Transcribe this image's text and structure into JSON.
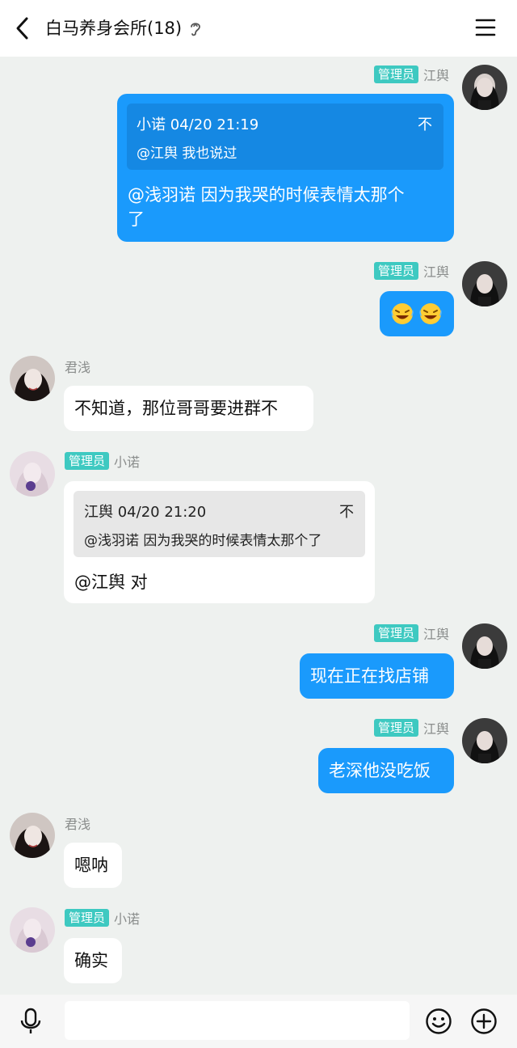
{
  "header": {
    "title": "白马养身会所(18)"
  },
  "messages": [
    {
      "side": "me",
      "badge": "管理员",
      "sender": "江舆",
      "quote": {
        "head": "小诺 04/20 21:19",
        "text": "@江舆 我也说过",
        "pin": "不"
      },
      "lines": [
        "@浅羽诺 因为我哭的时候表情太那个",
        "了"
      ]
    },
    {
      "side": "me",
      "badge": "管理员",
      "sender": "江舆",
      "emoji": [
        "laughing-crying-emoji",
        "laughing-crying-emoji"
      ]
    },
    {
      "side": "other",
      "sender": "君浅",
      "lines": [
        "不知道，那位哥哥要进群不"
      ]
    },
    {
      "side": "other",
      "badge": "管理员",
      "sender": "小诺",
      "quote": {
        "head": "江舆 04/20 21:20",
        "text": "@浅羽诺 因为我哭的时候表情太那个了",
        "pin": "不"
      },
      "lines": [
        "@江舆 对"
      ]
    },
    {
      "side": "me",
      "badge": "管理员",
      "sender": "江舆",
      "lines": [
        "现在正在找店铺"
      ]
    },
    {
      "side": "me",
      "badge": "管理员",
      "sender": "江舆",
      "lines": [
        "老深他没吃饭"
      ]
    },
    {
      "side": "other",
      "sender": "君浅",
      "lines": [
        "嗯呐"
      ]
    },
    {
      "side": "other",
      "badge": "管理员",
      "sender": "小诺",
      "lines": [
        "确实"
      ]
    }
  ],
  "input": {
    "value": "",
    "placeholder": ""
  },
  "colors": {
    "my_bubble": "#1a9afc",
    "admin_badge": "#3ec9c1",
    "background": "#eef1ef"
  },
  "icons": {
    "back": "chevron-left-icon",
    "ear": "ear-icon",
    "menu": "menu-icon",
    "voice": "microphone-icon",
    "emoji": "smiley-icon",
    "plus": "plus-circle-icon"
  }
}
